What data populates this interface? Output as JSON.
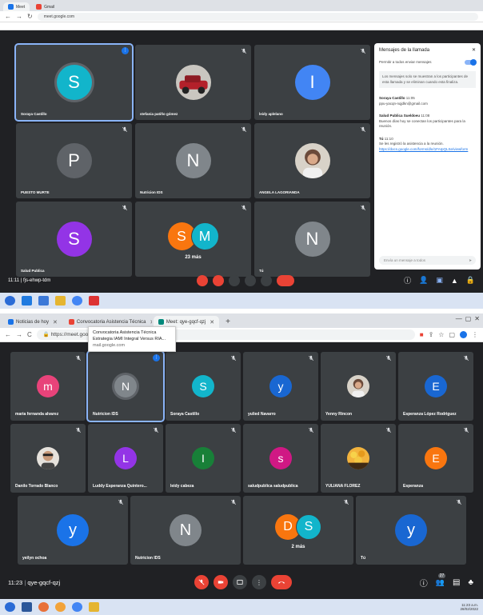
{
  "frame1": {
    "meeting_code": "11:11 | fjs-ehwp-tdm",
    "tiles": [
      {
        "name": "Soraya Castillo",
        "letter": "S",
        "color": "#12b5cb",
        "active": true
      },
      {
        "name": "stefania patiño gómez",
        "photo": "car"
      },
      {
        "name": "leidy aplelano",
        "letter": "I",
        "color": "#4285f4"
      },
      {
        "name": "PUESTO MURTE",
        "letter": "P",
        "color": "#5f6368"
      },
      {
        "name": "Nutricion IDS",
        "letter": "N",
        "color": "#80868b"
      },
      {
        "name": "ANGELA LAGORIANDA",
        "photo": "person"
      },
      {
        "name": "Salud Publica",
        "letter": "S",
        "color": "#9334e6"
      },
      {
        "name": "23 más",
        "group": [
          "S",
          "M"
        ]
      },
      {
        "name": "Tú",
        "letter": "N",
        "color": "#80868b"
      }
    ],
    "chat": {
      "title": "Mensajes de la llamada",
      "toggle_label": "Permitir a todos enviar mensajes",
      "note": "Los mensajes solo se muestran a los participantes de esta llamada y se eliminan cuando esta finaliza.",
      "messages": [
        {
          "author": "Soraya Castillo",
          "time": "11:05",
          "text": "ppu-yacqn-nqjdkn@gmail.com"
        },
        {
          "author": "Salud Publica Sueldoeu",
          "time": "11:08",
          "text": "Buenos días hoy se conectan los participantes para la reunión."
        },
        {
          "author": "Tú",
          "time": "11:10",
          "text": "Se les registró la asistencia a la reunión.",
          "link": "https://docs.google.com/forms/d/e/1FAIpQLSe/viewform"
        }
      ],
      "input_placeholder": "Envía un mensaje a todos"
    }
  },
  "frame2": {
    "tabs": [
      {
        "label": "Noticias de hoy",
        "color": "#1a73e8"
      },
      {
        "label": "Convocatoria Asistencia Técnica",
        "color": "#ea4335"
      },
      {
        "label": "Meet: qye-gqcf-qzj",
        "color": "#00897b"
      }
    ],
    "url": "https://meet.google.com/qye-gqcf-qzj",
    "tooltip": {
      "line1": "Convocatoria Asistencia Técnica",
      "line2": "Estrategia IAMI Integral Versus RIA...",
      "line3": "mail.google.com"
    },
    "meeting_time": "11:23",
    "meeting_code": "qye-gqcf-qzj",
    "participants_badge": "27",
    "tiles_row1": [
      {
        "name": "maria fernanda alvarez",
        "letter": "m",
        "color": "#e8437a"
      },
      {
        "name": "Nutricion IDS",
        "letter": "N",
        "color": "#80868b",
        "active": true
      },
      {
        "name": "Soraya Castillo",
        "letter": "S",
        "color": "#12b5cb"
      },
      {
        "name": "yulied Navarro",
        "letter": "y",
        "color": "#1967d2"
      },
      {
        "name": "Yenny Rincon",
        "photo": "person"
      },
      {
        "name": "Esperanza López Rodriguez",
        "letter": "E",
        "color": "#1967d2"
      }
    ],
    "tiles_row2": [
      {
        "name": "Danilo Torrado Blanco",
        "photo": "man"
      },
      {
        "name": "Luddy Esperanza Quintero...",
        "letter": "L",
        "color": "#9334e6"
      },
      {
        "name": "leidy cabeza",
        "letter": "I",
        "color": "#188038"
      },
      {
        "name": "saludpublica saludpublica",
        "letter": "s",
        "color": "#d01884"
      },
      {
        "name": "YULIANA FLOREZ",
        "photo": "flowers"
      },
      {
        "name": "Esperanza",
        "letter": "E",
        "color": "#f9760f"
      }
    ],
    "tiles_row3": [
      {
        "name": "yeilyn ochoa",
        "letter": "y",
        "color": "#1a73e8"
      },
      {
        "name": "Nutricion IDS",
        "letter": "N",
        "color": "#80868b"
      },
      {
        "name": "2 más",
        "group": [
          "D",
          "S"
        ]
      },
      {
        "name": "Tú",
        "letter": "y",
        "color": "#1967d2"
      }
    ],
    "tray_time": "11:23 a.m.",
    "tray_date": "28/02/2022"
  }
}
